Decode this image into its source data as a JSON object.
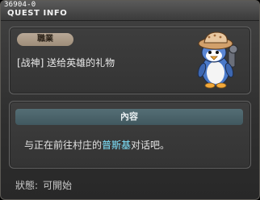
{
  "window": {
    "quest_id": "36904-0",
    "title": "QUEST INFO"
  },
  "job_panel": {
    "tag_label": "職業",
    "quest_name": "[战神] 送给英雄的礼物",
    "npc_portrait_icon": "penguin-with-hat-icon"
  },
  "content_panel": {
    "header_label": "內容",
    "description_prefix": "与正在前往村庄的",
    "npc_name": "普斯基",
    "description_suffix": "对话吧。",
    "npc_name_color": "#7fe4ff"
  },
  "status": {
    "label": "狀態:",
    "value": "可開始"
  }
}
